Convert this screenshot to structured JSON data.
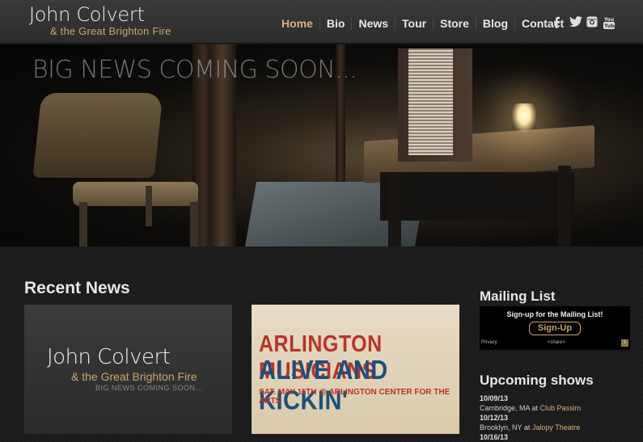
{
  "brand": {
    "title": "John Colvert",
    "subtitle": "& the Great Brighton Fire"
  },
  "nav": {
    "items": [
      {
        "label": "Home",
        "active": true
      },
      {
        "label": "Bio"
      },
      {
        "label": "News"
      },
      {
        "label": "Tour"
      },
      {
        "label": "Store"
      },
      {
        "label": "Blog"
      },
      {
        "label": "Contact"
      }
    ],
    "social": [
      {
        "icon": "facebook-icon",
        "glyph": "f"
      },
      {
        "icon": "twitter-icon",
        "glyph": "🐦"
      },
      {
        "icon": "instagram-icon",
        "glyph": "◙"
      },
      {
        "icon": "youtube-icon",
        "glyph": "You"
      }
    ]
  },
  "hero": {
    "headline": "BIG NEWS COMING SOON..."
  },
  "recent_news": {
    "title": "Recent News",
    "cards": [
      {
        "title": "John Colvert",
        "subtitle": "& the Great Brighton Fire",
        "tag": "BIG NEWS COMING SOON..."
      },
      {
        "line1": "ARLINGTON MUSICIANS",
        "line2": "ALIVE AND KICKIN'",
        "line3": "SAT. MAY 11TH @ ARLINGTON CENTER FOR THE ARTS"
      }
    ]
  },
  "mailing_list": {
    "title": "Mailing List",
    "heading": "Sign-up for the Mailing List!",
    "button": "Sign-Up",
    "privacy": "Privacy",
    "share": "<share>",
    "info": "i"
  },
  "shows": {
    "title": "Upcoming shows",
    "items": [
      {
        "date": "10/09/13",
        "location": "Cambridge, MA at",
        "venue": "Club Passim"
      },
      {
        "date": "10/12/13",
        "location": "Brooklyn, NY at",
        "venue": "Jalopy Theatre"
      },
      {
        "date": "10/16/13",
        "location": "",
        "venue": ""
      }
    ]
  },
  "colors": {
    "accent": "#d7b27a",
    "gold": "#c8a66b",
    "poster_red": "#b8342a",
    "poster_blue": "#1c4f7a"
  }
}
